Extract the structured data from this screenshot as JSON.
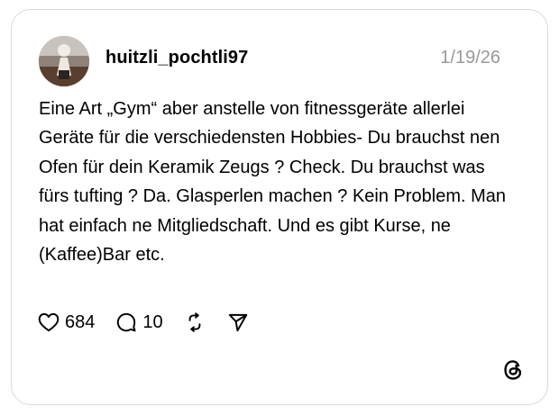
{
  "post": {
    "username": "huitzli_pochtli97",
    "date": "1/19/26",
    "text": "Eine Art „Gym“ aber anstelle von fitnessgeräte allerlei Geräte für die verschiedensten Hobbies- Du brauchst nen Ofen für dein Keramik Zeugs ? Check. Du brauchst was fürs tufting ? Da. Glasperlen machen ? Kein Problem. Man hat einfach ne Mitgliedschaft. Und es gibt Kurse, ne (Kaffee)Bar etc."
  },
  "actions": {
    "likes": "684",
    "replies": "10",
    "icons": [
      "heart-icon",
      "comment-icon",
      "repost-icon",
      "share-icon"
    ]
  },
  "brand": {
    "logo": "threads-logo-icon"
  }
}
